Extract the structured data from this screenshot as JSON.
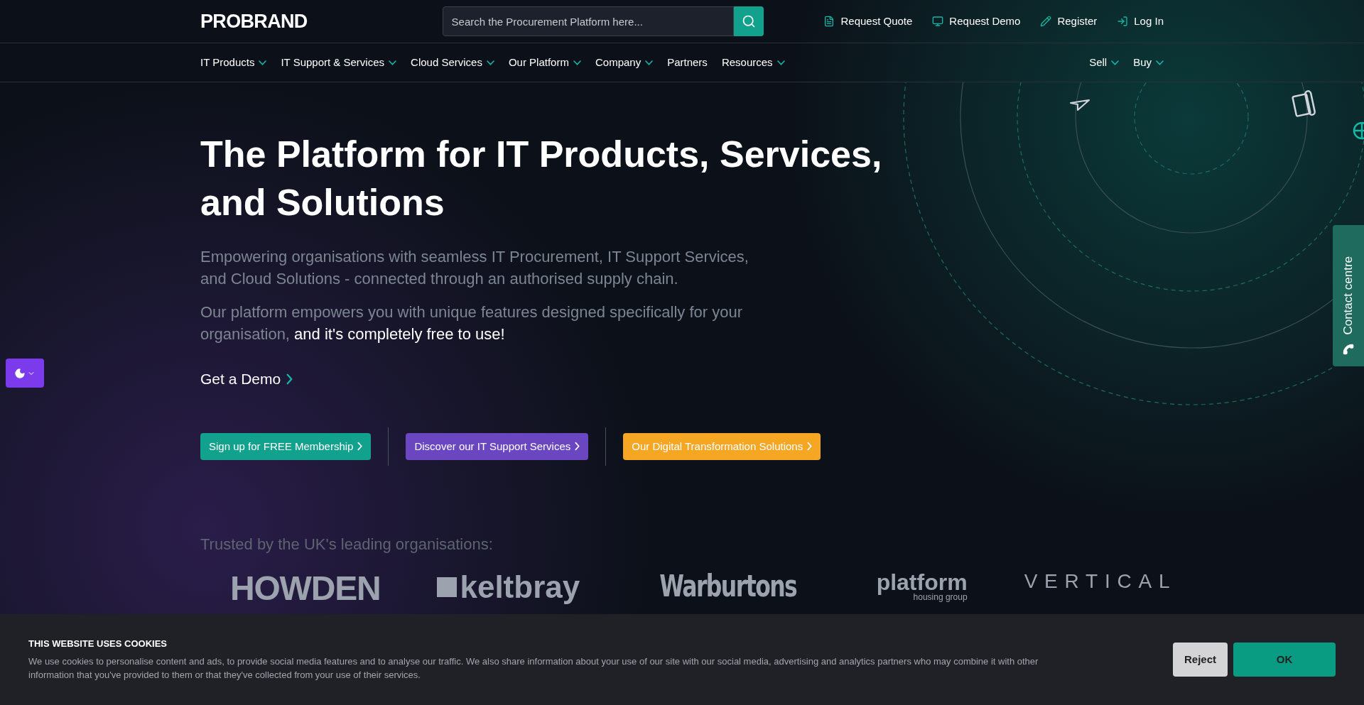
{
  "header": {
    "logo": "PROBRAND",
    "search": {
      "placeholder": "Search the Procurement Platform here..."
    },
    "links": [
      {
        "kind": "quote",
        "label": "Request Quote"
      },
      {
        "kind": "demo",
        "label": "Request Demo"
      },
      {
        "kind": "register",
        "label": "Register"
      },
      {
        "kind": "login",
        "label": "Log In"
      }
    ]
  },
  "nav": {
    "items": [
      {
        "label": "IT Products",
        "dropdown": true
      },
      {
        "label": "IT Support & Services",
        "dropdown": true
      },
      {
        "label": "Cloud Services",
        "dropdown": true
      },
      {
        "label": "Our Platform",
        "dropdown": true
      },
      {
        "label": "Company",
        "dropdown": true
      },
      {
        "label": "Partners",
        "dropdown": false
      },
      {
        "label": "Resources",
        "dropdown": true
      }
    ],
    "right_items": [
      {
        "label": "Sell",
        "dropdown": true
      },
      {
        "label": "Buy",
        "dropdown": true
      }
    ]
  },
  "hero": {
    "heading": "The Platform for IT Products, Services, and Solutions",
    "subtitle": "Empowering organisations with seamless IT Procurement, IT Support Services, and Cloud Solutions - connected through an authorised supply chain.",
    "paragraph": "Our platform empowers you with unique features designed specifically for your organisation,",
    "paragraph_highlight": "and it's completely free to use!",
    "demo_link": "Get a Demo",
    "buttons": [
      {
        "label": "Sign up for FREE Membership",
        "color": "#12a18c"
      },
      {
        "label": "Discover our IT Support Services",
        "color": "#6b46c1"
      },
      {
        "label": "Our Digital Transformation Solutions",
        "color": "#f5a623"
      }
    ]
  },
  "trusted": {
    "title": "Trusted by the UK's leading organisations:",
    "logos": [
      {
        "kind": "howden",
        "text": "HOWDEN"
      },
      {
        "kind": "keltbray",
        "text": "keltbray"
      },
      {
        "kind": "warburtons",
        "text": "Warburtons"
      },
      {
        "kind": "platform",
        "text": "platform",
        "subtext": "housing group"
      },
      {
        "kind": "vertical",
        "text": "VERTICAL"
      }
    ]
  },
  "contact_tab": {
    "label": "Contact centre"
  },
  "cookie_banner": {
    "title": "THIS WEBSITE USES COOKIES",
    "text": "We use cookies to personalise content and ads, to provide social media features and to analyse our traffic. We also share information about your use of our site with our social media, advertising and analytics partners who may combine it with other information that you've provided to them or that they've collected from your use of their services.",
    "reject": "Reject",
    "accept": "OK"
  }
}
